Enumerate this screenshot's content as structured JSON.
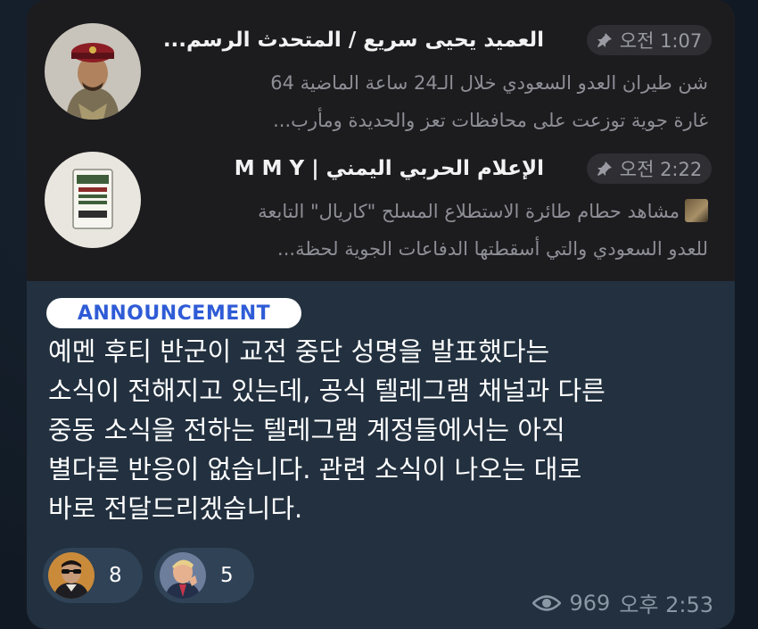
{
  "pinned_chats": [
    {
      "name": "العميد يحيى سريع / المتحدث الرسم...",
      "time": "오전 1:07",
      "preview_lines": [
        "شن طيران العدو السعودي خلال الـ24 ساعة الماضية 64",
        "غارة جوية توزعت على محافظات تعز والحديدة ومأرب..."
      ],
      "avatar_icon": "military-officer-avatar"
    },
    {
      "name": "الإعلام الحربي اليمني | M M Y",
      "time": "오전 2:22",
      "preview_lines": [
        "مشاهد حطام طائرة الاستطلاع المسلح \"كاريال\" التابعة",
        "للعدو السعودي والتي أسقطتها الدفاعات الجوية لحظة..."
      ],
      "avatar_icon": "war-media-logo-avatar"
    }
  ],
  "tag": "ANNOUNCEMENT",
  "message_lines": [
    "예멘 후티 반군이 교전 중단 성명을 발표했다는",
    "소식이 전해지고 있는데, 공식 텔레그램 채널과 다른",
    "중동 소식을 전하는 텔레그램 계정들에서는 아직",
    "별다른 반응이 없습니다. 관련 소식이 나오는 대로",
    "바로 전달드리겠습니다."
  ],
  "reactions": [
    {
      "icon": "sunglasses-man-reaction",
      "count": "8"
    },
    {
      "icon": "suited-man-reaction",
      "count": "5"
    }
  ],
  "views": "969",
  "sent_time": "오후 2:53",
  "colors": {
    "bubble": "#22303f",
    "preview_bg": "#1c1c1f",
    "tag_text": "#2f5bd6",
    "reaction_bg": "#2f4256"
  }
}
